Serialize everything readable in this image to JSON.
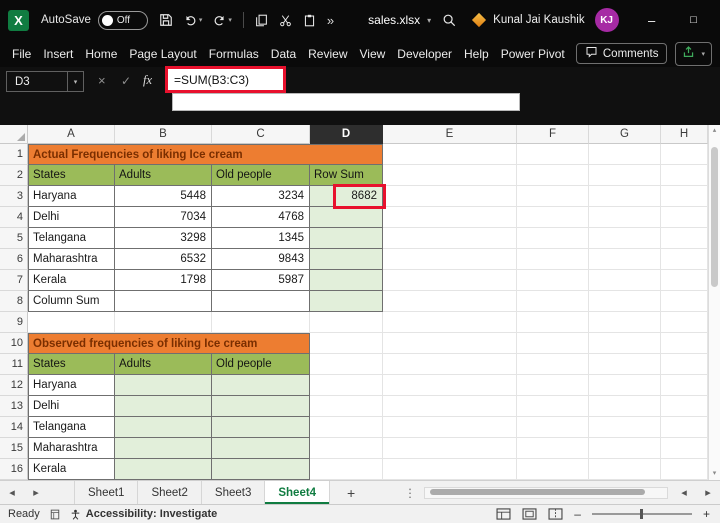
{
  "titlebar": {
    "autosave_label": "AutoSave",
    "autosave_state": "Off",
    "filename": "sales.xlsx",
    "user_name": "Kunal Jai Kaushik",
    "user_initials": "KJ"
  },
  "ribbon": {
    "tabs": [
      "File",
      "Insert",
      "Home",
      "Page Layout",
      "Formulas",
      "Data",
      "Review",
      "View",
      "Developer",
      "Help",
      "Power Pivot"
    ],
    "comments_label": "Comments"
  },
  "formula_bar": {
    "name_box": "D3",
    "fx_label": "fx",
    "formula": "=SUM(B3:C3)"
  },
  "grid": {
    "column_headers": [
      "A",
      "B",
      "C",
      "D",
      "E",
      "F",
      "G",
      "H"
    ],
    "selected_column": "D",
    "selected_cell": "D3",
    "row_count": 16
  },
  "tables": [
    {
      "title": "Actual Frequencies of liking Ice cream",
      "title_row": 1,
      "columns": [
        "A",
        "B",
        "C",
        "D"
      ],
      "header_row": 2,
      "headers": [
        "States",
        "Adults",
        "Old people",
        "Row Sum"
      ],
      "data_rows": [
        {
          "row": 3,
          "cells": [
            "Haryana",
            "5448",
            "3234",
            "8682"
          ]
        },
        {
          "row": 4,
          "cells": [
            "Delhi",
            "7034",
            "4768",
            ""
          ]
        },
        {
          "row": 5,
          "cells": [
            "Telangana",
            "3298",
            "1345",
            ""
          ]
        },
        {
          "row": 6,
          "cells": [
            "Maharashtra",
            "6532",
            "9843",
            ""
          ]
        },
        {
          "row": 7,
          "cells": [
            "Kerala",
            "1798",
            "5987",
            ""
          ]
        },
        {
          "row": 8,
          "cells": [
            "Column Sum",
            "",
            "",
            ""
          ]
        }
      ],
      "green_fill_columns": [
        "D"
      ]
    },
    {
      "title": "Observed frequencies of liking Ice cream",
      "title_row": 10,
      "columns": [
        "A",
        "B",
        "C"
      ],
      "header_row": 11,
      "headers": [
        "States",
        "Adults",
        "Old people"
      ],
      "data_rows": [
        {
          "row": 12,
          "cells": [
            "Haryana",
            "",
            ""
          ]
        },
        {
          "row": 13,
          "cells": [
            "Delhi",
            "",
            ""
          ]
        },
        {
          "row": 14,
          "cells": [
            "Telangana",
            "",
            ""
          ]
        },
        {
          "row": 15,
          "cells": [
            "Maharashtra",
            "",
            ""
          ]
        },
        {
          "row": 16,
          "cells": [
            "Kerala",
            "",
            ""
          ]
        }
      ],
      "green_fill_columns": [
        "B",
        "C"
      ]
    }
  ],
  "sheet_tabs": {
    "sheets": [
      "Sheet1",
      "Sheet2",
      "Sheet3",
      "Sheet4"
    ],
    "active": "Sheet4",
    "add_label": "+"
  },
  "status_bar": {
    "ready_label": "Ready",
    "accessibility_label": "Accessibility: Investigate"
  },
  "colors": {
    "excel_green": "#107C41",
    "title_orange": "#ED7D31",
    "table_title_text": "#7A2E00",
    "header_green": "#9BBB59",
    "light_green": "#E2EFDA",
    "annotation_red": "#E8112D",
    "active_sheet_green": "#107C41",
    "avatar_purple": "#A62AA4"
  }
}
